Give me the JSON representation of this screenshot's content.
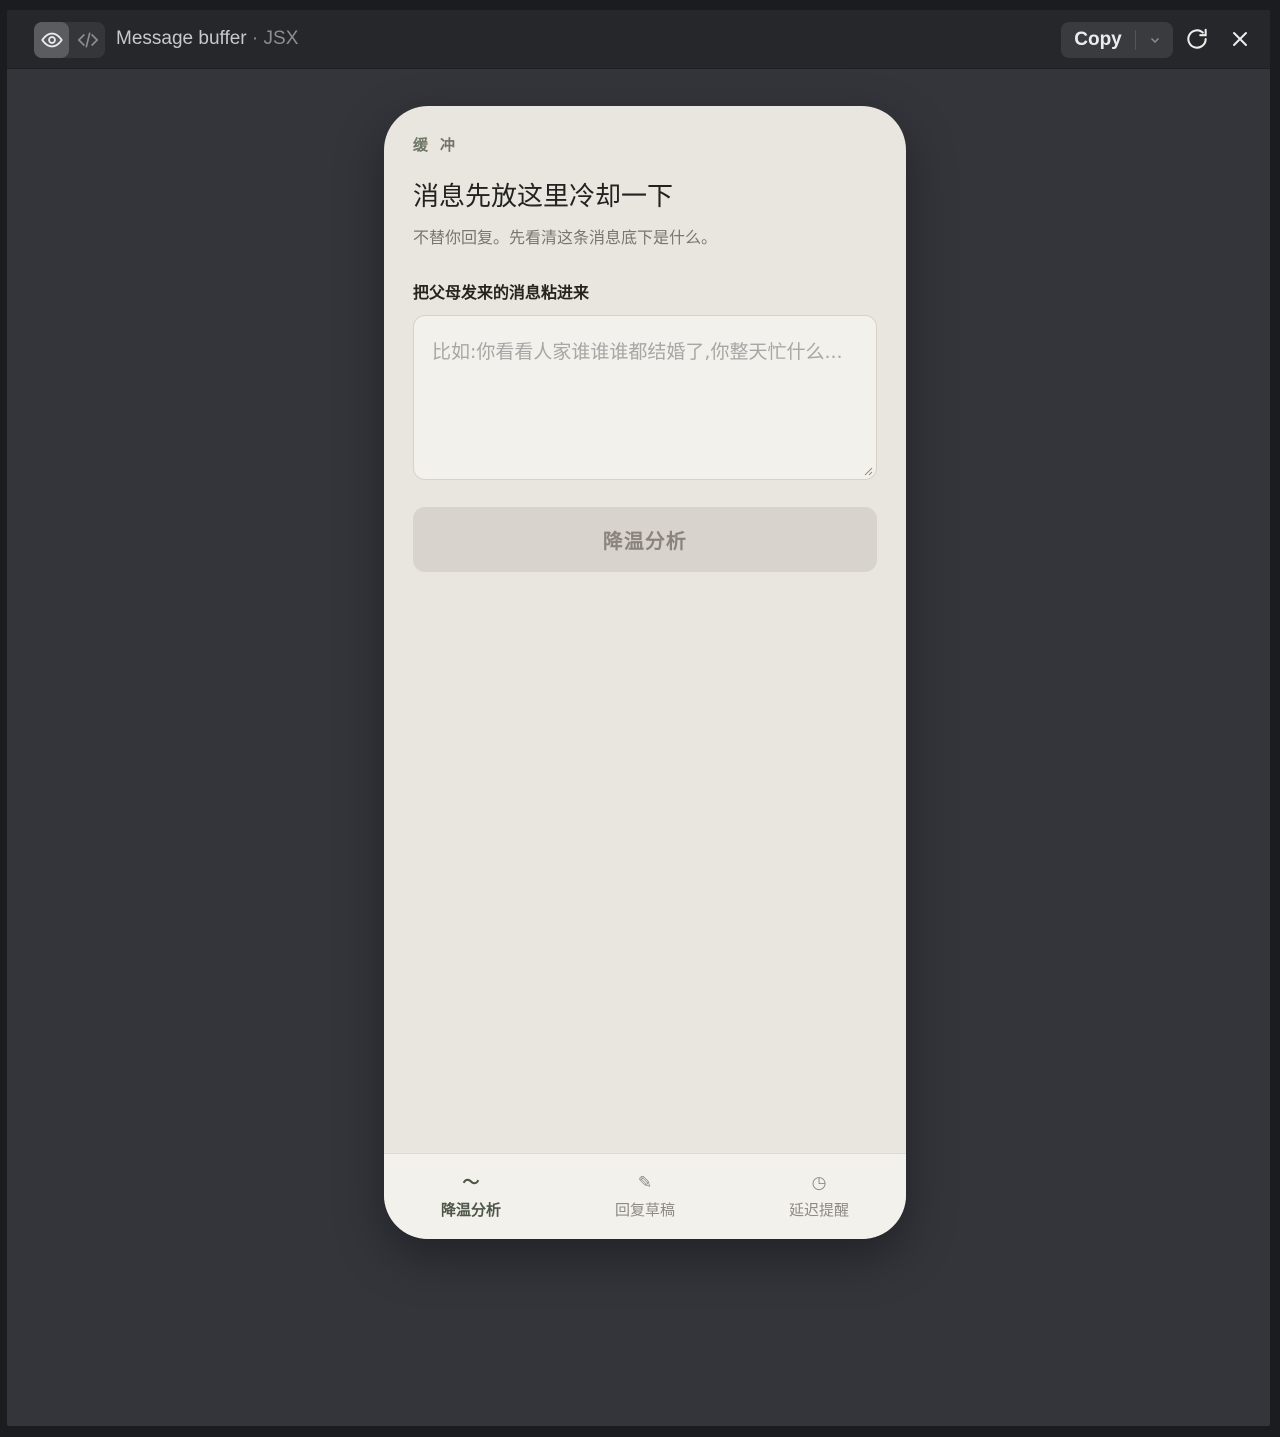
{
  "titlebar": {
    "title": "Message buffer",
    "separator": " · ",
    "language": "JSX",
    "copy_label": "Copy",
    "icons": [
      "eye-icon",
      "code-icon",
      "chevron-down-icon",
      "refresh-icon",
      "close-icon"
    ]
  },
  "app": {
    "eyebrow": "缓冲",
    "heading": "消息先放这里冷却一下",
    "subheading": "不替你回复。先看清这条消息底下是什么。",
    "field_label": "把父母发来的消息粘进来",
    "textarea_value": "",
    "textarea_placeholder": "比如:你看看人家谁谁谁都结婚了,你整天忙什么...",
    "analyze_button": "降温分析",
    "tabs": [
      {
        "label": "降温分析",
        "icon": "wave-icon",
        "glyph": "〜",
        "active": true
      },
      {
        "label": "回复草稿",
        "icon": "pencil-icon",
        "glyph": "✎",
        "active": false
      },
      {
        "label": "延迟提醒",
        "icon": "clock-icon",
        "glyph": "◷",
        "active": false
      }
    ]
  },
  "colors": {
    "window_bg": "#33353b",
    "phone_bg": "#e9e6df",
    "accent_green": "#6d7565",
    "button_bg": "#d8d3cc",
    "status_dot": "#6c63ff"
  }
}
